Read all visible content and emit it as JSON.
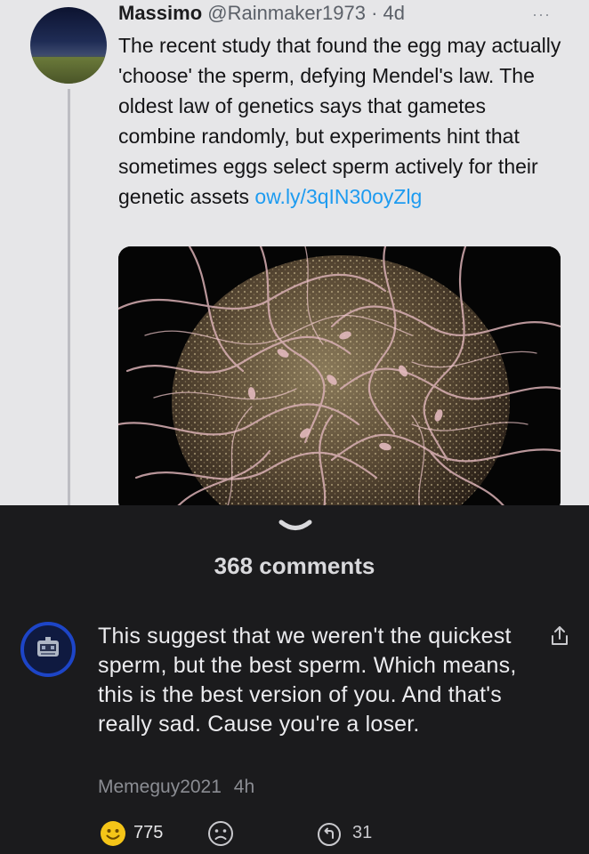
{
  "tweet": {
    "name": "Massimo",
    "handle": "@Rainmaker1973",
    "separator": "·",
    "time": "4d",
    "more": "···",
    "text": "The recent study that found the egg may actually 'choose' the sperm, defying Mendel's law. The oldest law of genetics says that gametes combine randomly, but experiments hint that sometimes eggs select sperm actively for their genetic assets",
    "link": "ow.ly/3qIN30oyZlg",
    "link_color": "#1d9bf0"
  },
  "comments": {
    "count_label": "368 comments",
    "items": [
      {
        "text": "This suggest that we weren't the quickest sperm, but the best sperm. Which means, this is the best version of you. And that's really sad. Cause you're a loser.",
        "author": "Memeguy2021",
        "time": "4h",
        "reactions": {
          "smile_count": "775",
          "reply_count": "31"
        }
      }
    ]
  },
  "icons": [
    "more-icon",
    "collapse-chevron-icon",
    "share-icon",
    "smile-emoji-icon",
    "frown-emoji-icon",
    "reply-icon"
  ],
  "colors": {
    "tweet_bg": "#e6e6e8",
    "comments_bg": "#1b1b1d",
    "avatar_ring": "#1d45c7",
    "emoji_yellow": "#f5c518"
  }
}
